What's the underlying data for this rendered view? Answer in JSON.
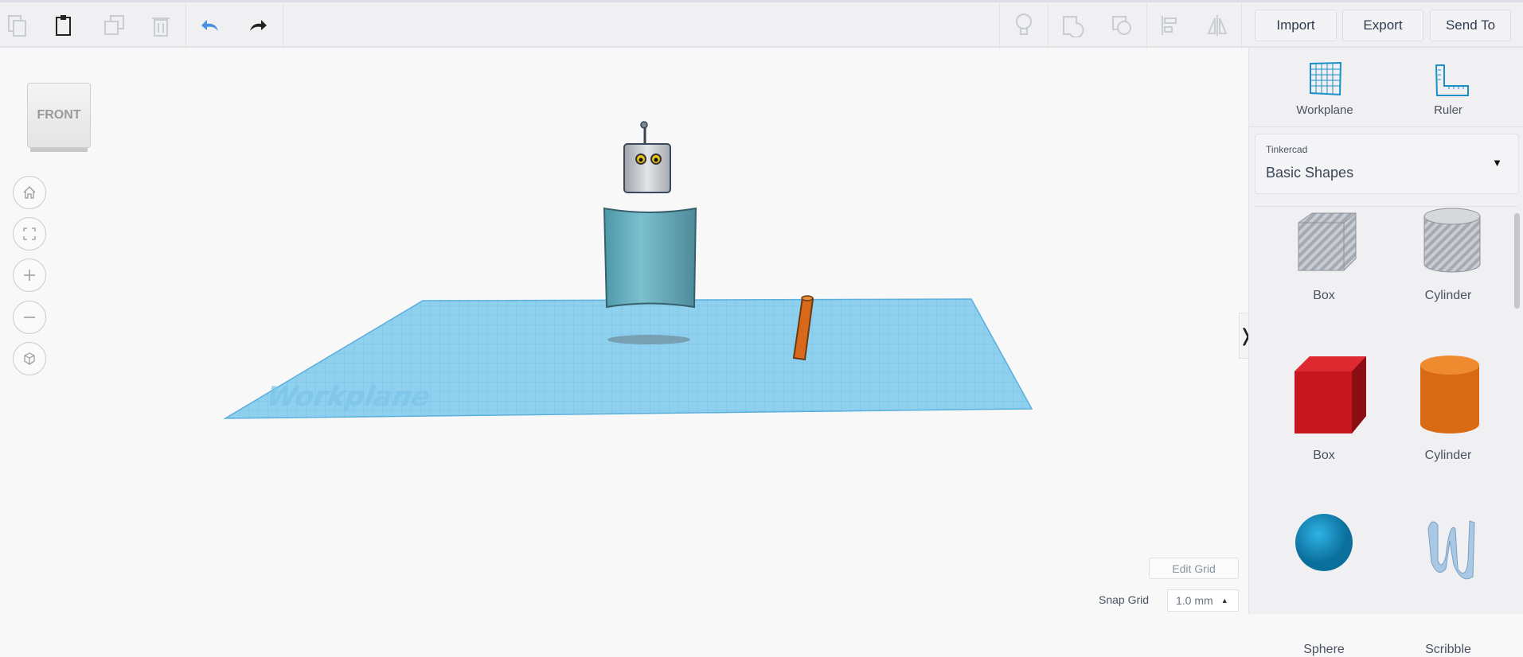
{
  "toolbar": {
    "left_tools": [
      {
        "name": "copy-icon"
      },
      {
        "name": "paste-icon"
      },
      {
        "name": "duplicate-icon"
      },
      {
        "name": "delete-icon"
      },
      {
        "name": "undo-icon"
      },
      {
        "name": "redo-icon"
      }
    ],
    "right_tools": [
      {
        "name": "lightbulb-icon"
      },
      {
        "name": "group-icon"
      },
      {
        "name": "ungroup-icon"
      },
      {
        "name": "align-icon"
      },
      {
        "name": "mirror-icon"
      }
    ],
    "import_label": "Import",
    "export_label": "Export",
    "send_to_label": "Send To"
  },
  "viewport": {
    "viewcube_label": "FRONT",
    "workplane_watermark": "Workplane",
    "edit_grid_label": "Edit Grid",
    "snap_grid_label": "Snap Grid",
    "snap_grid_value": "1.0 mm"
  },
  "panel": {
    "workplane_label": "Workplane",
    "ruler_label": "Ruler",
    "library_caption": "Tinkercad",
    "library_value": "Basic Shapes",
    "shapes": [
      {
        "label": "Box",
        "color": "#b9bcc4"
      },
      {
        "label": "Cylinder",
        "color": "#c4c6cc"
      },
      {
        "label": "Box",
        "color": "#c8161f"
      },
      {
        "label": "Cylinder",
        "color": "#e0731c"
      },
      {
        "label": "Sphere",
        "color": "#1593c7"
      },
      {
        "label": "Scribble",
        "color": "#a8c8e6"
      }
    ]
  },
  "colors": {
    "accent": "#1aa0d8",
    "workplane": "#8fd0ef"
  }
}
